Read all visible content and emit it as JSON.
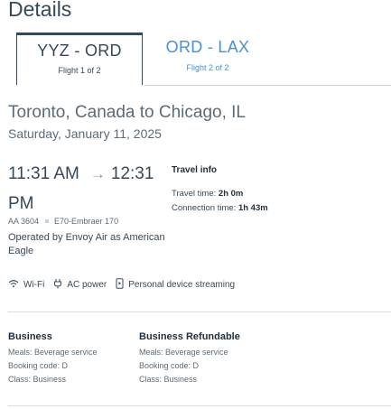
{
  "page": {
    "title": "Details"
  },
  "tabs": [
    {
      "route": "YYZ - ORD",
      "sub": "Flight 1 of 2",
      "active": true
    },
    {
      "route": "ORD - LAX",
      "sub": "Flight 2 of 2",
      "active": false
    }
  ],
  "flight": {
    "route_title": "Toronto, Canada to Chicago, IL",
    "date": "Saturday, January 11, 2025",
    "depart_time": "11:31 AM",
    "arrive_time": "12:31 PM",
    "flight_number": "AA 3604",
    "aircraft": "E70-Embraer 170",
    "operated_by": "Operated by Envoy Air as American Eagle"
  },
  "travel_info": {
    "heading": "Travel info",
    "travel_time_label": "Travel time:",
    "travel_time_value": "2h 0m",
    "connection_time_label": "Connection time:",
    "connection_time_value": "1h 43m"
  },
  "amenities": [
    {
      "icon": "wifi-icon",
      "label": "Wi-Fi"
    },
    {
      "icon": "power-plug-icon",
      "label": "AC power"
    },
    {
      "icon": "device-streaming-icon",
      "label": "Personal device streaming"
    }
  ],
  "cabins": [
    {
      "title": "Business",
      "meals": "Meals: Beverage service",
      "booking": "Booking code: D",
      "class": "Class: Business"
    },
    {
      "title": "Business Refundable",
      "meals": "Meals: Beverage service",
      "booking": "Booking code: D",
      "class": "Class: Business"
    }
  ]
}
